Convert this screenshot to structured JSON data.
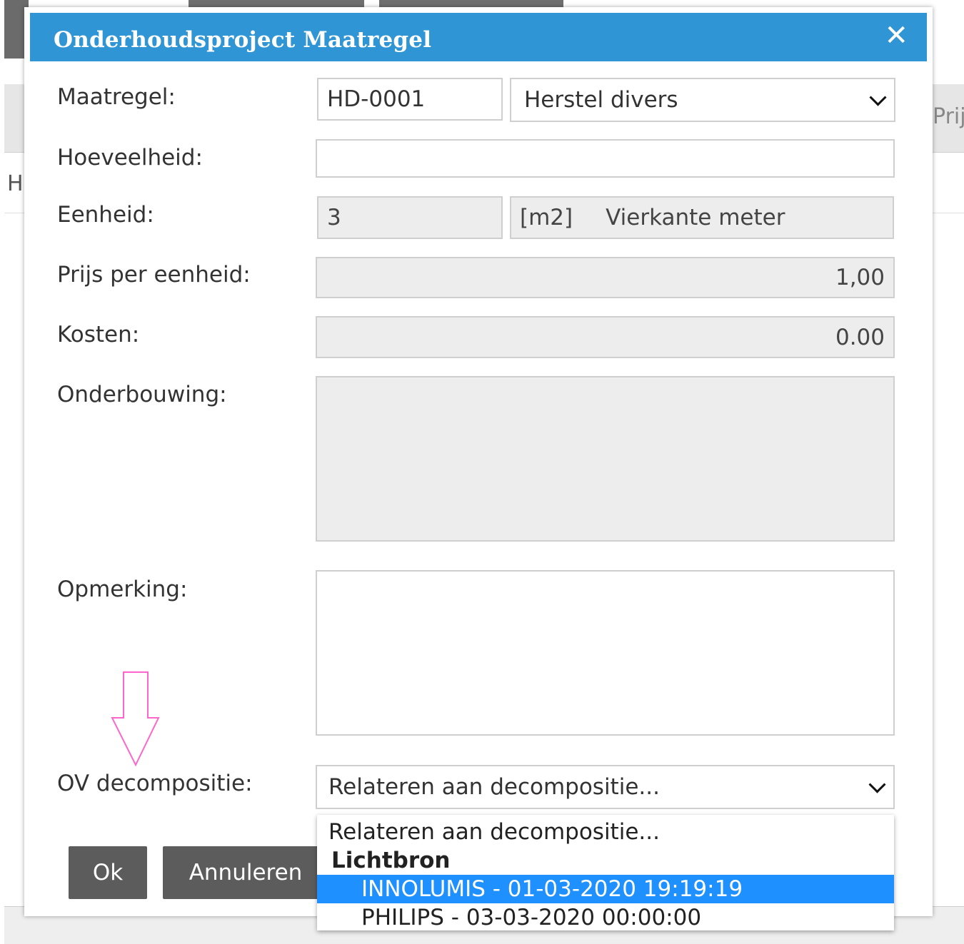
{
  "dialog": {
    "title": "Onderhoudsproject Maatregel",
    "close": "✕"
  },
  "background": {
    "left_letter": "H",
    "right_text": "Prij"
  },
  "fields": {
    "maatregel": {
      "label": "Maatregel:",
      "code": "HD-0001",
      "select": "Herstel divers"
    },
    "hoeveelheid": {
      "label": "Hoeveelheid:",
      "value": ""
    },
    "eenheid": {
      "label": "Eenheid:",
      "code": "3",
      "unit": "[m2]",
      "unit_name": "Vierkante meter"
    },
    "prijs": {
      "label": "Prijs per eenheid:",
      "value": "1,00"
    },
    "kosten": {
      "label": "Kosten:",
      "value": "0.00"
    },
    "onderbouwing": {
      "label": "Onderbouwing:",
      "value": ""
    },
    "opmerking": {
      "label": "Opmerking:",
      "value": ""
    },
    "ov": {
      "label": "OV decompositie:",
      "select": "Relateren aan decompositie..."
    }
  },
  "dropdown": {
    "placeholder": "Relateren aan decompositie...",
    "group": "Lichtbron",
    "options": [
      {
        "label": "INNOLUMIS - 01-03-2020 19:19:19",
        "selected": true
      },
      {
        "label": "PHILIPS - 03-03-2020 00:00:00",
        "selected": false
      }
    ]
  },
  "buttons": {
    "ok": "Ok",
    "cancel": "Annuleren"
  },
  "colors": {
    "titlebar": "#2f95d4",
    "selected": "#1e90ff",
    "button": "#5c5c5c",
    "arrow": "#ff66cc"
  },
  "icons": {
    "close": "close-icon",
    "arrow": "down-arrow-annotation-icon"
  }
}
